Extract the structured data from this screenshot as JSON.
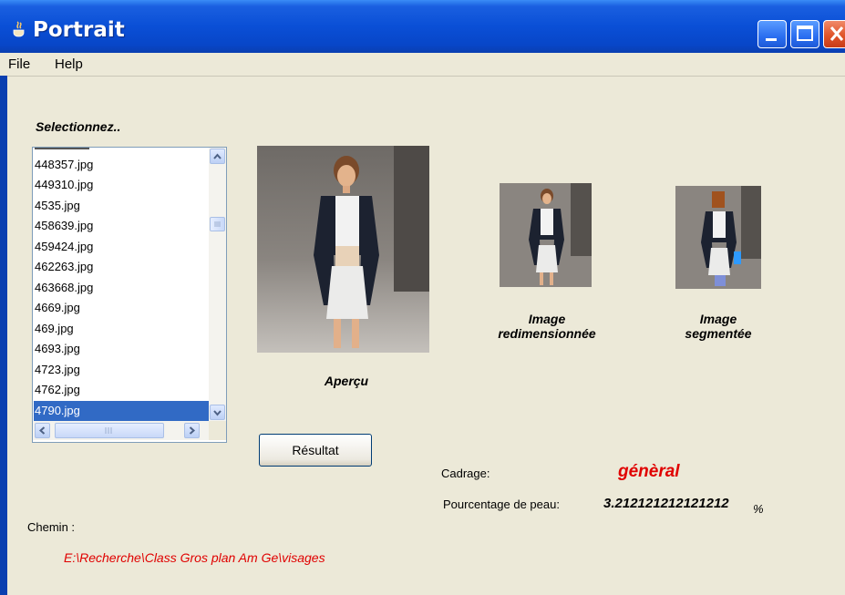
{
  "window": {
    "title": "Portrait"
  },
  "menu": [
    "File",
    "Help"
  ],
  "select_label": "Selectionnez..",
  "files": {
    "items": [
      "448357.jpg",
      "449310.jpg",
      "4535.jpg",
      "458639.jpg",
      "459424.jpg",
      "462263.jpg",
      "463668.jpg",
      "4669.jpg",
      "469.jpg",
      "4693.jpg",
      "4723.jpg",
      "4762.jpg",
      "4790.jpg"
    ],
    "selected": "4790.jpg"
  },
  "captions": {
    "preview": "Aperçu",
    "resized": [
      "Image",
      "redimensionnée"
    ],
    "segmented": [
      "Image",
      "segmentée"
    ]
  },
  "result_button": "Résultat",
  "framing": {
    "label": "Cadrage:",
    "value": "génèral"
  },
  "skin": {
    "label": "Pourcentage de peau:",
    "value": "3.212121212121212",
    "unit": "%"
  },
  "path": {
    "label": "Chemin :",
    "value": "E:\\Recherche\\Class Gros plan Am Ge\\visages"
  },
  "colors": {
    "accent_red": "#e00000",
    "selection": "#316ac5",
    "titlebar": "#0a4fd6"
  }
}
